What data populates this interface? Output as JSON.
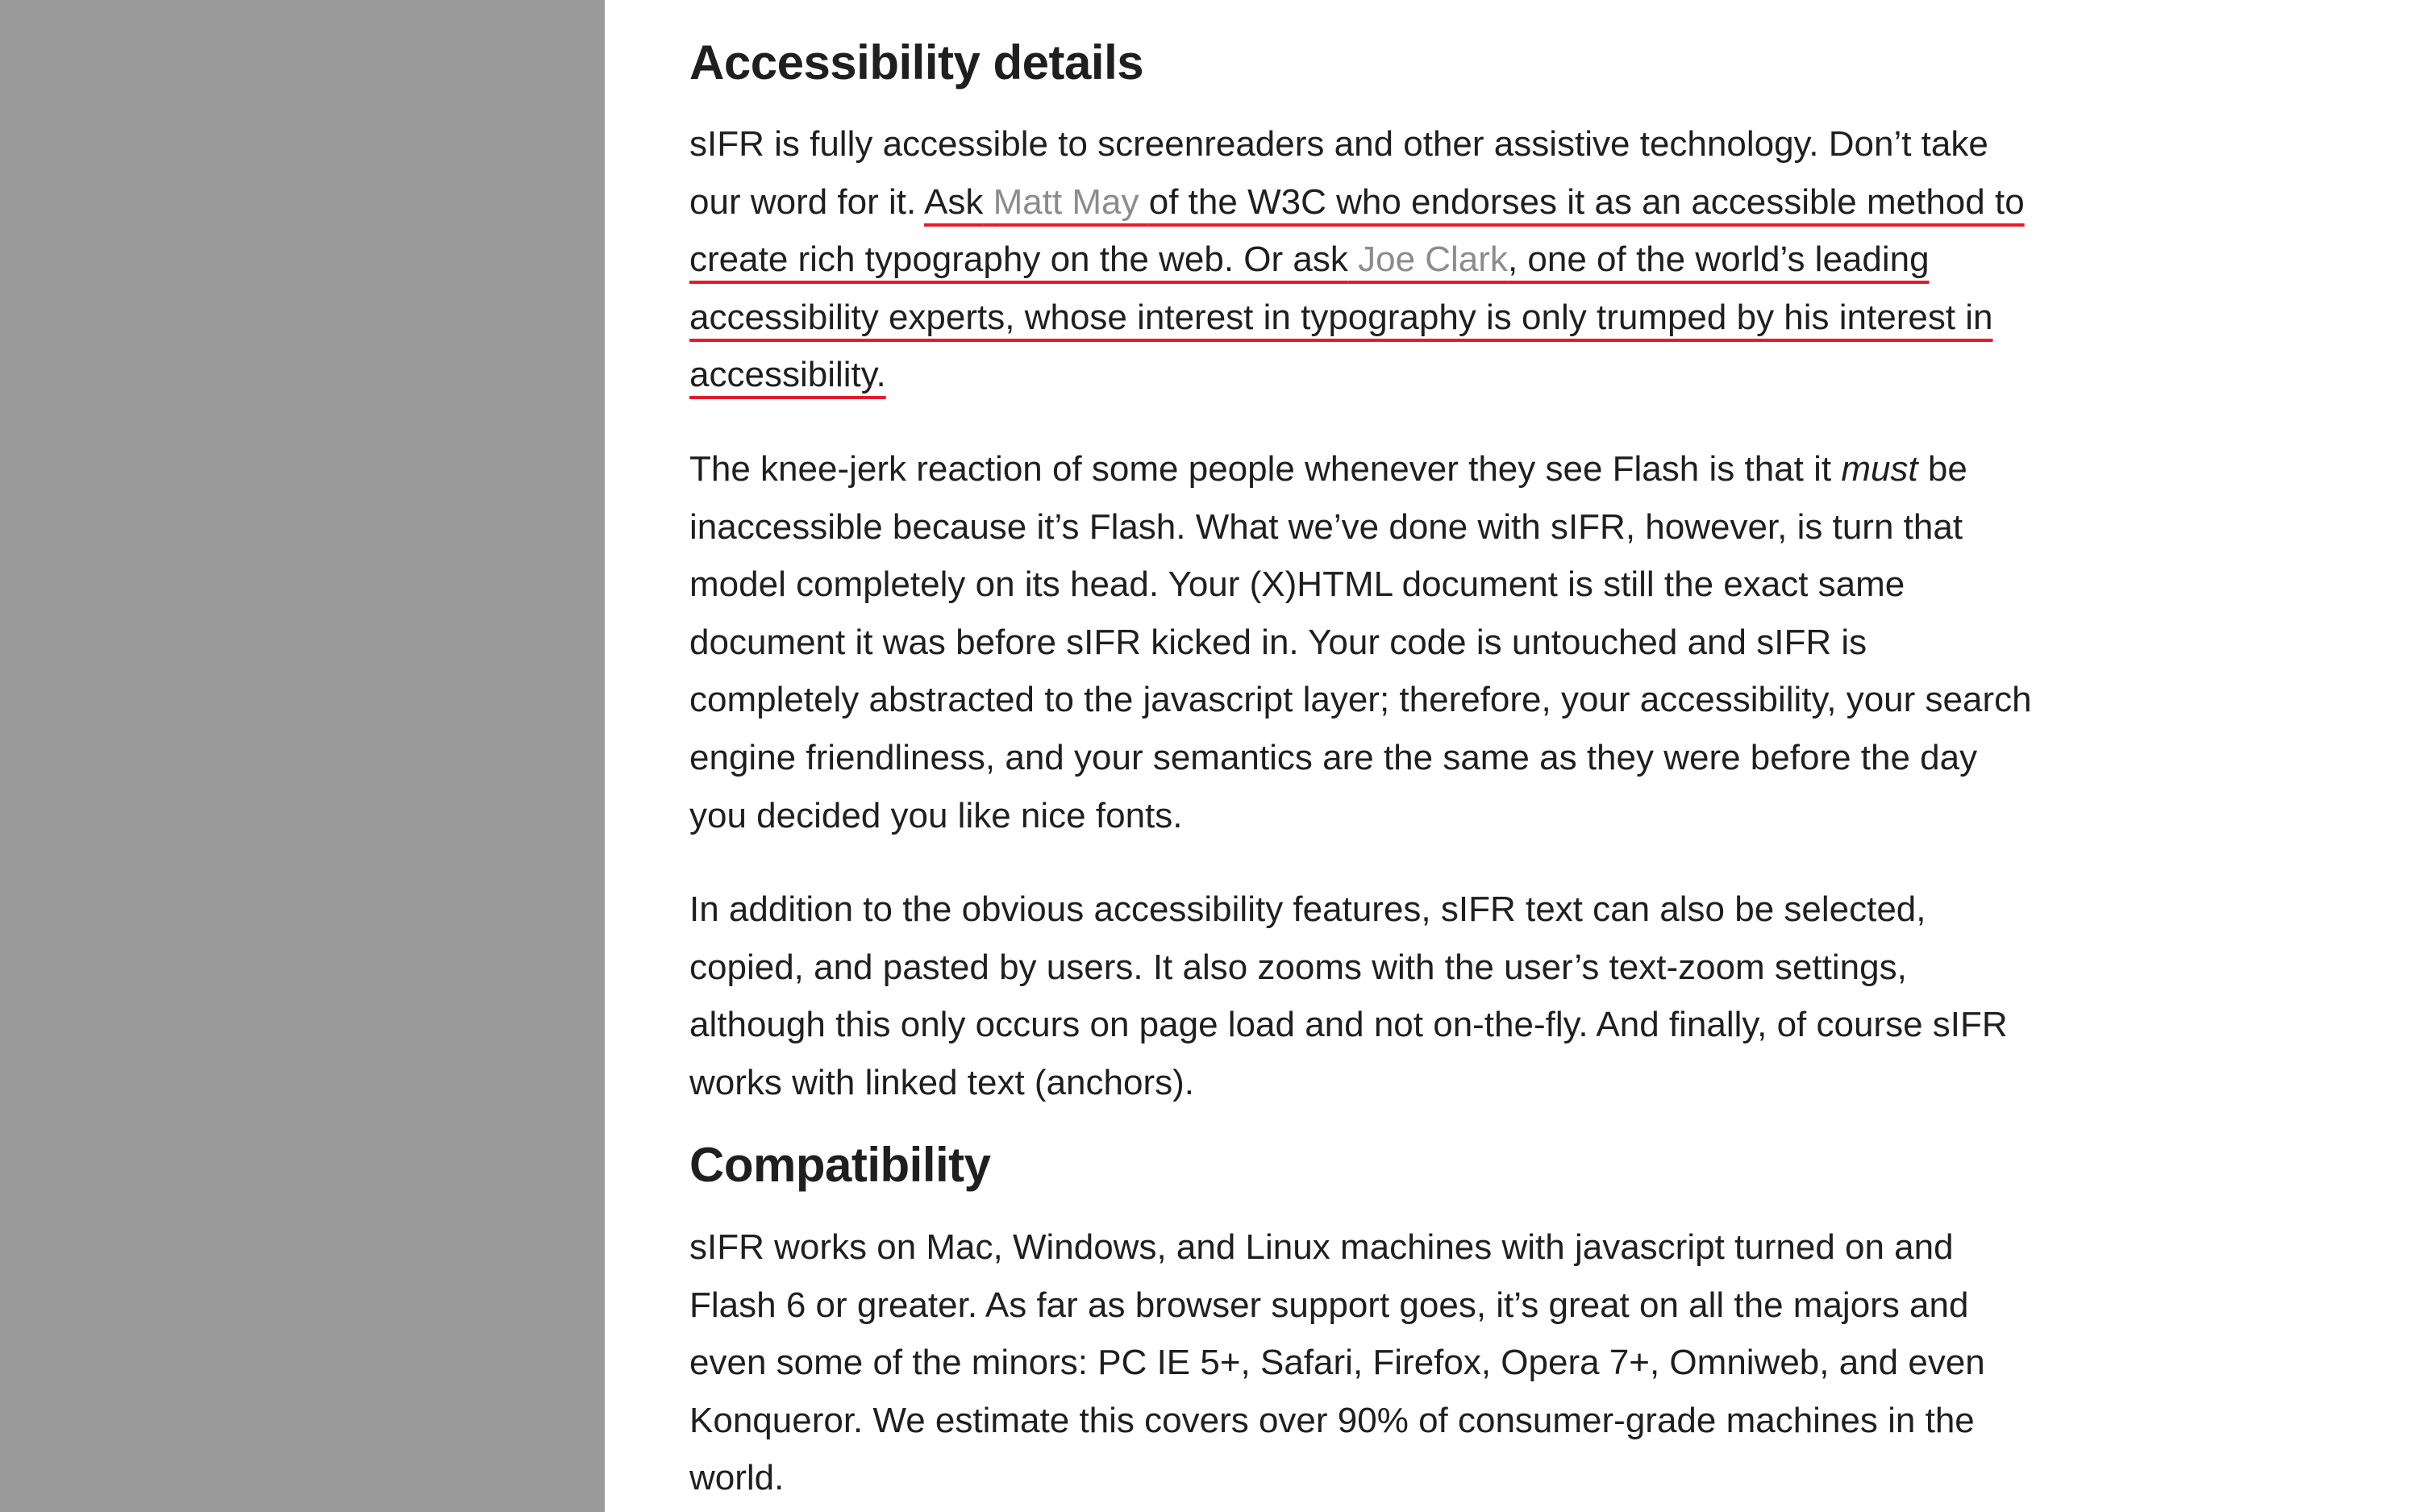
{
  "sections": {
    "accessibility": {
      "heading": "Accessibility details",
      "p1": {
        "intro": "sIFR is fully accessible to screenreaders and other assistive technology. Don’t take our word for it.",
        "ask": "Ask",
        "link1": "Matt May",
        "mid1": "of the W3C who endorses it as an accessible method to create rich typography on the web. Or ask",
        "link2": "Joe Clark",
        "mid2": ", one of the world’s leading accessibility experts, whose interest in typography is only trumped by his interest in accessibility."
      },
      "p2": {
        "before": "The knee-jerk reaction of some people whenever they see Flash is that it ",
        "emphasis": "must",
        "after": " be inaccessible because it’s Flash. What we’ve done with sIFR, however, is turn that model completely on its head. Your (X)HTML document is still the exact same document it was before sIFR kicked in. Your code is untouched and sIFR is completely abstracted to the javascript layer; therefore, your accessibility, your search engine friendliness, and your semantics are the same as they were before the day you decided you like nice fonts."
      },
      "p3": "In addition to the obvious accessibility features, sIFR text can also be selected, copied, and pasted by users. It also zooms with the user’s text-zoom settings, although this only occurs on page load and not on-the-fly. And finally, of course sIFR works with linked text (anchors)."
    },
    "compatibility": {
      "heading": "Compatibility",
      "p1": "sIFR works on Mac, Windows, and Linux machines with javascript turned on and Flash 6 or greater. As far as browser support goes, it’s great on all the majors and even some of the minors: PC IE 5+, Safari, Firefox, Opera 7+, Omniweb, and even Konqueror. We estimate this covers over 90% of consumer-grade machines in the world."
    }
  },
  "colors": {
    "sidebar": "#9a9a9a",
    "text": "#1f1f1f",
    "link": "#8c8c8c",
    "highlight_underline": "#e8192c"
  }
}
